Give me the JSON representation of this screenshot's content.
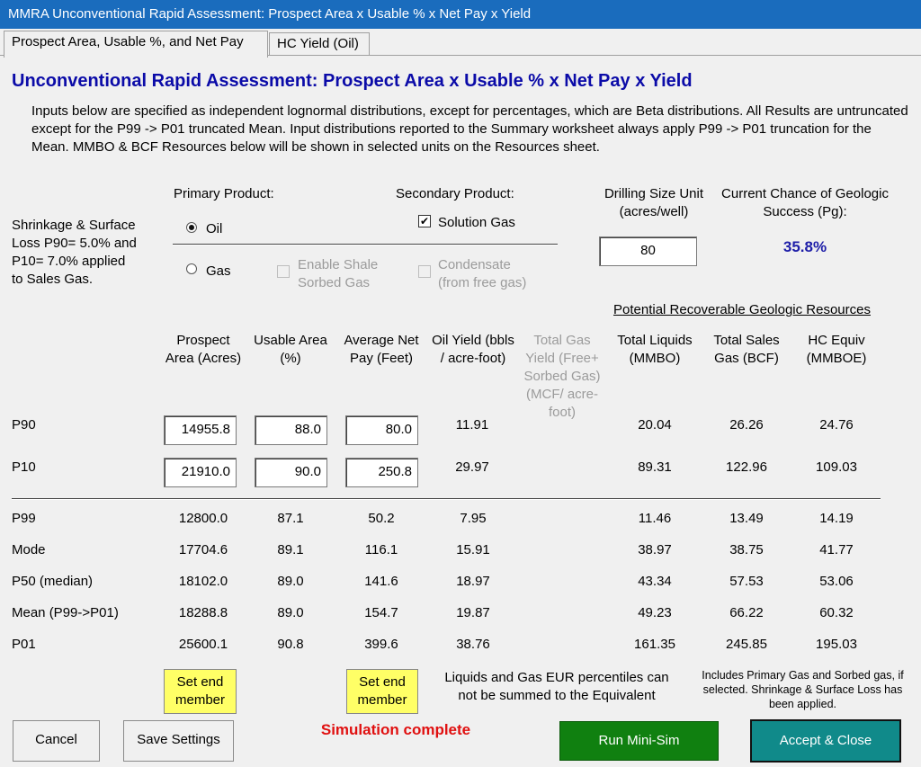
{
  "window": {
    "title": "MMRA Unconventional Rapid Assessment: Prospect Area x Usable % x Net Pay x Yield"
  },
  "tabs": [
    {
      "label": "Prospect Area, Usable %, and Net Pay"
    },
    {
      "label": "HC Yield (Oil)"
    }
  ],
  "heading": "Unconventional Rapid Assessment: Prospect Area x Usable % x Net Pay x Yield",
  "intro": "Inputs below are specified as independent lognormal distributions, except for percentages, which are Beta distributions. All Results are untruncated except for the P99 -> P01 truncated Mean. Input distributions reported to the Summary worksheet always apply P99 -> P01 truncation for the Mean. MMBO & BCF Resources below will be shown in selected units on the Resources sheet.",
  "shrinkage_note": "Shrinkage & Surface Loss P90= 5.0% and P10= 7.0% applied to Sales Gas.",
  "primary": {
    "label": "Primary Product:",
    "options": [
      {
        "label": "Oil",
        "checked": true
      },
      {
        "label": "Gas",
        "checked": false
      }
    ]
  },
  "secondary": {
    "label": "Secondary Product:",
    "solution_gas": {
      "label": "Solution Gas",
      "checked": true
    },
    "shale_sorbed": {
      "label": "Enable Shale Sorbed Gas",
      "checked": false
    },
    "condensate": {
      "label": "Condensate (from free gas)",
      "checked": false
    }
  },
  "drilling": {
    "label": "Drilling Size Unit (acres/well)",
    "value": "80"
  },
  "pg": {
    "label": "Current Chance of Geologic Success (Pg):",
    "value": "35.8%"
  },
  "resources_header": "Potential Recoverable Geologic Resources",
  "columns": [
    "Prospect Area (Acres)",
    "Usable Area (%)",
    "Average Net Pay (Feet)",
    "Oil Yield (bbls / acre-foot)",
    "Total Gas Yield (Free+ Sorbed Gas) (MCF/ acre-foot)",
    "Total Liquids (MMBO)",
    "Total Sales Gas (BCF)",
    "HC Equiv (MMBOE)"
  ],
  "input_rows": [
    {
      "label": "P90",
      "area": "14955.8",
      "usable": "88.0",
      "netpay": "80.0",
      "oil_yield": "11.91",
      "liquids": "20.04",
      "gas": "26.26",
      "hce": "24.76"
    },
    {
      "label": "P10",
      "area": "21910.0",
      "usable": "90.0",
      "netpay": "250.8",
      "oil_yield": "29.97",
      "liquids": "89.31",
      "gas": "122.96",
      "hce": "109.03"
    }
  ],
  "result_rows": [
    {
      "label": "P99",
      "v": [
        "12800.0",
        "87.1",
        "50.2",
        "7.95",
        "11.46",
        "13.49",
        "14.19"
      ]
    },
    {
      "label": "Mode",
      "v": [
        "17704.6",
        "89.1",
        "116.1",
        "15.91",
        "38.97",
        "38.75",
        "41.77"
      ]
    },
    {
      "label": "P50 (median)",
      "v": [
        "18102.0",
        "89.0",
        "141.6",
        "18.97",
        "43.34",
        "57.53",
        "53.06"
      ]
    },
    {
      "label": "Mean (P99->P01)",
      "v": [
        "18288.8",
        "89.0",
        "154.7",
        "19.87",
        "49.23",
        "66.22",
        "60.32"
      ]
    },
    {
      "label": "P01",
      "v": [
        "25600.1",
        "90.8",
        "399.6",
        "38.76",
        "161.35",
        "245.85",
        "195.03"
      ]
    }
  ],
  "set_end_member": "Set end member",
  "eur_note": "Liquids and Gas EUR percentiles can not be summed to the Equivalent",
  "gas_note": "Includes Primary Gas and Sorbed gas, if selected. Shrinkage & Surface Loss has been applied.",
  "status": "Simulation complete",
  "buttons": {
    "cancel": "Cancel",
    "save": "Save Settings",
    "run": "Run Mini-Sim",
    "accept": "Accept & Close"
  },
  "colors": {
    "titlebar": "#1a6cbd",
    "heading": "#0b0ba8",
    "pg": "#1e1ea8",
    "status": "#e01010",
    "run": "#108010",
    "accept": "#108a8a",
    "set_end": "#ffff66"
  }
}
